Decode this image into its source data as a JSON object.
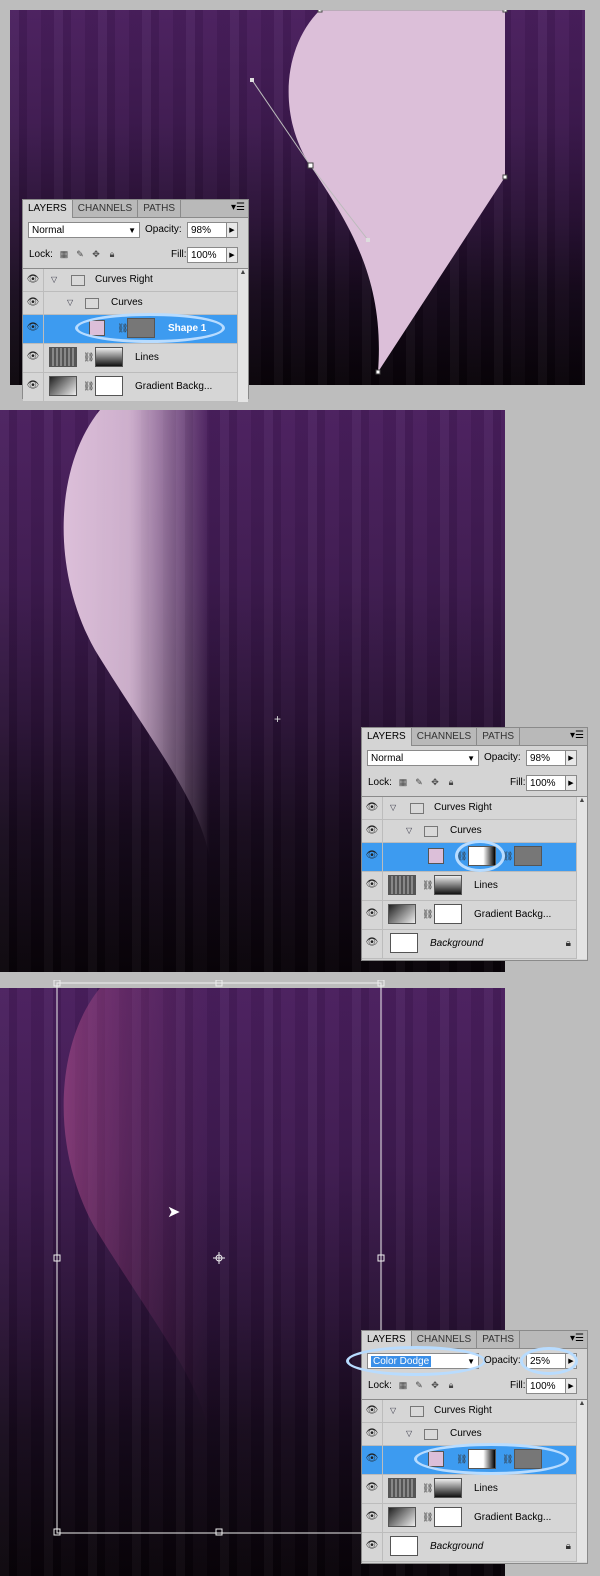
{
  "panels": [
    {
      "tabs": [
        "LAYERS",
        "CHANNELS",
        "PATHS"
      ],
      "blend_mode": "Normal",
      "opacity_label": "Opacity:",
      "opacity": "98%",
      "lock_label": "Lock:",
      "fill_label": "Fill:",
      "fill": "100%",
      "layers": [
        "Curves Right",
        "Curves",
        "Shape 1",
        "Lines",
        "Gradient Backg..."
      ]
    },
    {
      "tabs": [
        "LAYERS",
        "CHANNELS",
        "PATHS"
      ],
      "blend_mode": "Normal",
      "opacity_label": "Opacity:",
      "opacity": "98%",
      "lock_label": "Lock:",
      "fill_label": "Fill:",
      "fill": "100%",
      "layers": [
        "Curves Right",
        "Curves",
        "...",
        "Lines",
        "Gradient Backg...",
        "Background"
      ]
    },
    {
      "tabs": [
        "LAYERS",
        "CHANNELS",
        "PATHS"
      ],
      "blend_mode": "Color Dodge",
      "opacity_label": "Opacity:",
      "opacity": "25%",
      "lock_label": "Lock:",
      "fill_label": "Fill:",
      "fill": "100%",
      "layers": [
        "Curves Right",
        "Curves",
        "...",
        "Lines",
        "Gradient Backg...",
        "Background"
      ]
    }
  ],
  "colors": {
    "selection": "#3d9bf0",
    "shape_fill": "#dcbfd9",
    "highlight_ring": "#b8dcff"
  },
  "icons": [
    "eye-icon",
    "folder-icon",
    "chain-link-icon",
    "lock-icon",
    "move-cursor-icon"
  ]
}
